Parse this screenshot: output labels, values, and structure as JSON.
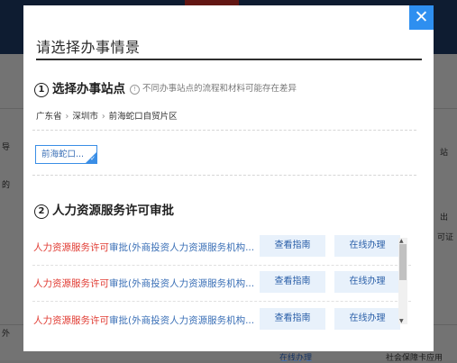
{
  "modal": {
    "title": "请选择办事情景",
    "close_glyph": "✕"
  },
  "step1": {
    "num": "1",
    "title": "选择办事站点",
    "hint": "不同办事站点的流程和材料可能存在差异",
    "breadcrumb": [
      "广东省",
      "深圳市",
      "前海蛇口自贸片区"
    ],
    "selected_site": "前海蛇口..."
  },
  "step2": {
    "num": "2",
    "title": "人力资源服务许可审批",
    "rows": [
      {
        "red": "人力资源服务许可",
        "blue": "审批(外商投资人力资源服务机构...",
        "guide": "查看指南",
        "online": "在线办理"
      },
      {
        "red": "人力资源服务许可",
        "blue": "审批(外商投资人力资源服务机构...",
        "guide": "查看指南",
        "online": "在线办理"
      },
      {
        "red": "人力资源服务许可",
        "blue": "审批(外商投资人力资源服务机构...",
        "guide": "查看指南",
        "online": "在线办理"
      }
    ]
  },
  "background": {
    "left_1": "导",
    "left_2": "的",
    "right_1": "站",
    "right_2": "出",
    "right_3": "可证",
    "bottom_left": "外",
    "bottom_btn": "在线办理",
    "bottom_right": "社会保障卡应用"
  },
  "colors": {
    "accent": "#2e8ff0",
    "red_text": "#e03a31",
    "blue_text": "#3a6fb6",
    "button_bg": "#e8f1fb"
  }
}
